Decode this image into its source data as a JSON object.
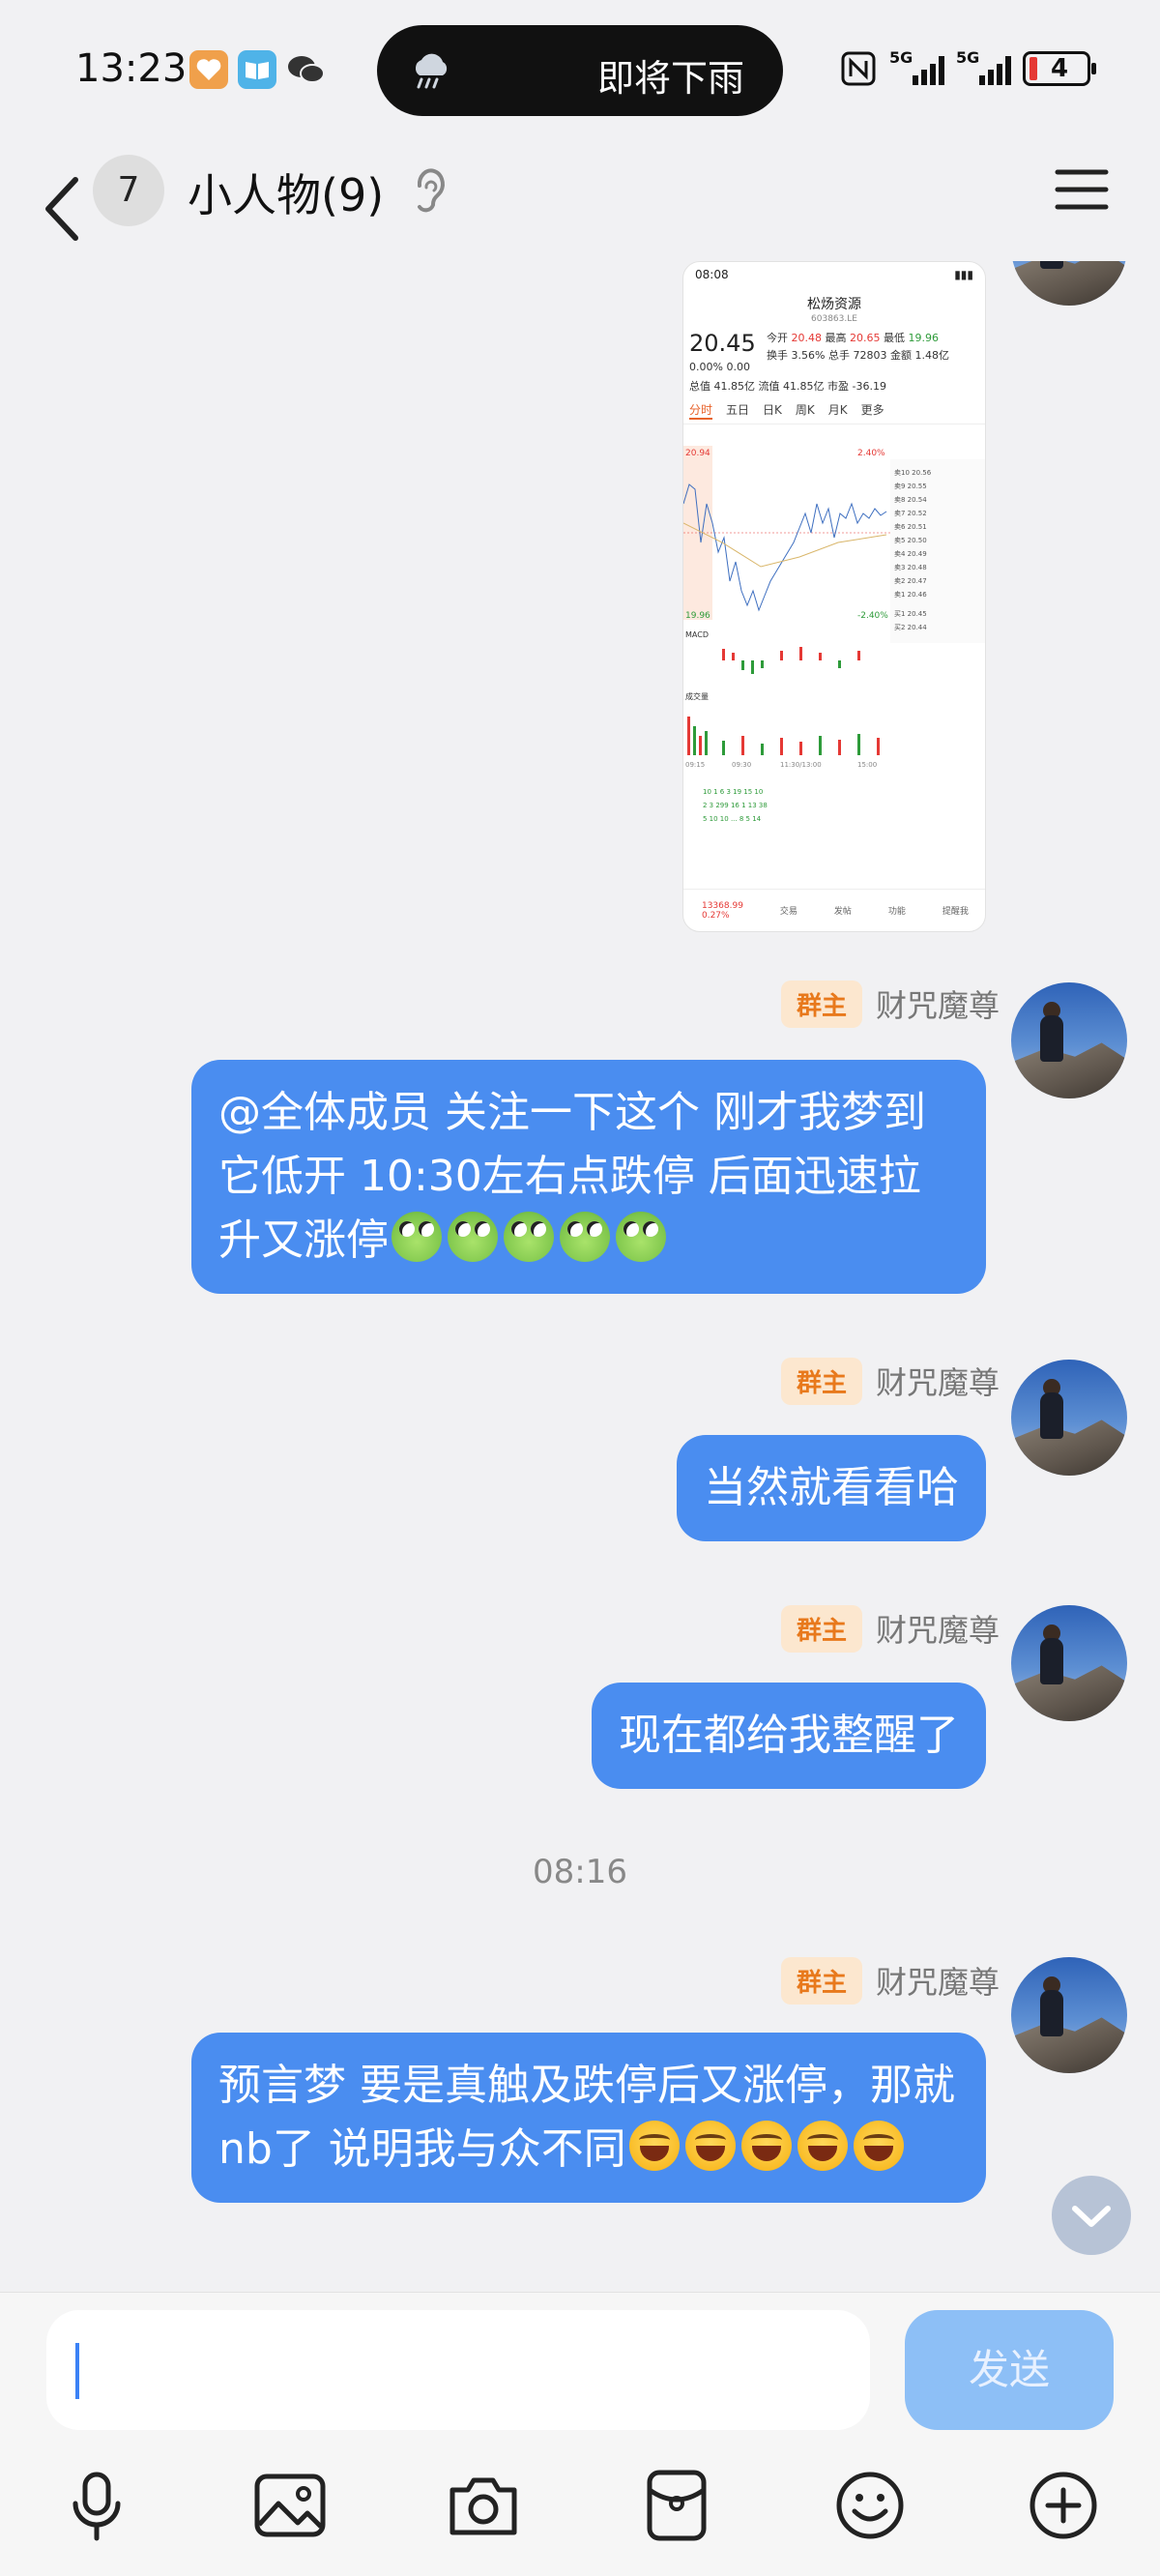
{
  "status_bar": {
    "time": "13:23",
    "weather_text": "即将下雨",
    "signal1": "5G",
    "signal2": "5G",
    "battery": "4",
    "icons": [
      "nfc-icon",
      "signal-icon",
      "battery-icon"
    ],
    "app_icons": [
      "heart-app-icon",
      "book-app-icon",
      "wechat-icon"
    ]
  },
  "header": {
    "unread_count": "7",
    "title": "小人物(9)",
    "ear_icon": "ear-icon",
    "menu_icon": "menu-icon"
  },
  "shared_screenshot": {
    "time": "08:08",
    "stock_name": "松炀资源",
    "stock_code": "603863.LE",
    "price": "20.45",
    "change_pct": "0.00%",
    "change": "0.00",
    "open_label": "今开",
    "open": "20.48",
    "high_label": "最高",
    "high": "20.65",
    "low_label": "最低",
    "low": "19.96",
    "turnover_label": "换手",
    "turnover": "3.56%",
    "volume_label": "总手",
    "volume": "72803",
    "amount_label": "金额",
    "amount": "1.48亿",
    "total_cap_label": "总值",
    "total_cap": "41.85亿",
    "float_cap_label": "流值",
    "float_cap": "41.85亿",
    "pe_label": "市盈",
    "pe": "-36.19",
    "more": "更多",
    "tabs": [
      "分时",
      "五日",
      "日K",
      "周K",
      "月K",
      "更多"
    ],
    "chart_high": "20.94",
    "chart_low": "19.96",
    "pct_high": "2.40%",
    "pct_low": "-2.40%",
    "indicator": "MACD",
    "vol_label": "成交量",
    "times": [
      "09:15",
      "09:30",
      "11:30/13:00",
      "15:00"
    ],
    "index_value": "13368.99",
    "index_change": "0.27%",
    "bottom_tabs": [
      "交易",
      "发帖",
      "功能",
      "提醒我"
    ]
  },
  "messages": [
    {
      "role": "群主",
      "sender": "财咒魔尊",
      "text": "@全体成员 关注一下这个 刚才我梦到它低开 10:30左右点跌停 后面迅速拉升又涨停",
      "emoji": "frog",
      "emoji_count": 5
    },
    {
      "role": "群主",
      "sender": "财咒魔尊",
      "text": "当然就看看哈"
    },
    {
      "role": "群主",
      "sender": "财咒魔尊",
      "text": "现在都给我整醒了"
    },
    {
      "timestamp": "08:16"
    },
    {
      "role": "群主",
      "sender": "财咒魔尊",
      "text": "预言梦 要是真触及跌停后又涨停，那就nb了 说明我与众不同",
      "emoji": "smile",
      "emoji_count": 5
    }
  ],
  "input": {
    "placeholder": "",
    "send_label": "发送"
  },
  "toolbar": [
    "microphone-icon",
    "image-icon",
    "camera-icon",
    "red-packet-icon",
    "emoji-icon",
    "plus-icon"
  ],
  "colors": {
    "bubble": "#4a8df0",
    "role_badge_bg": "#fce7cf",
    "role_badge_text": "#e8791c",
    "send_button": "#8dbff6"
  }
}
